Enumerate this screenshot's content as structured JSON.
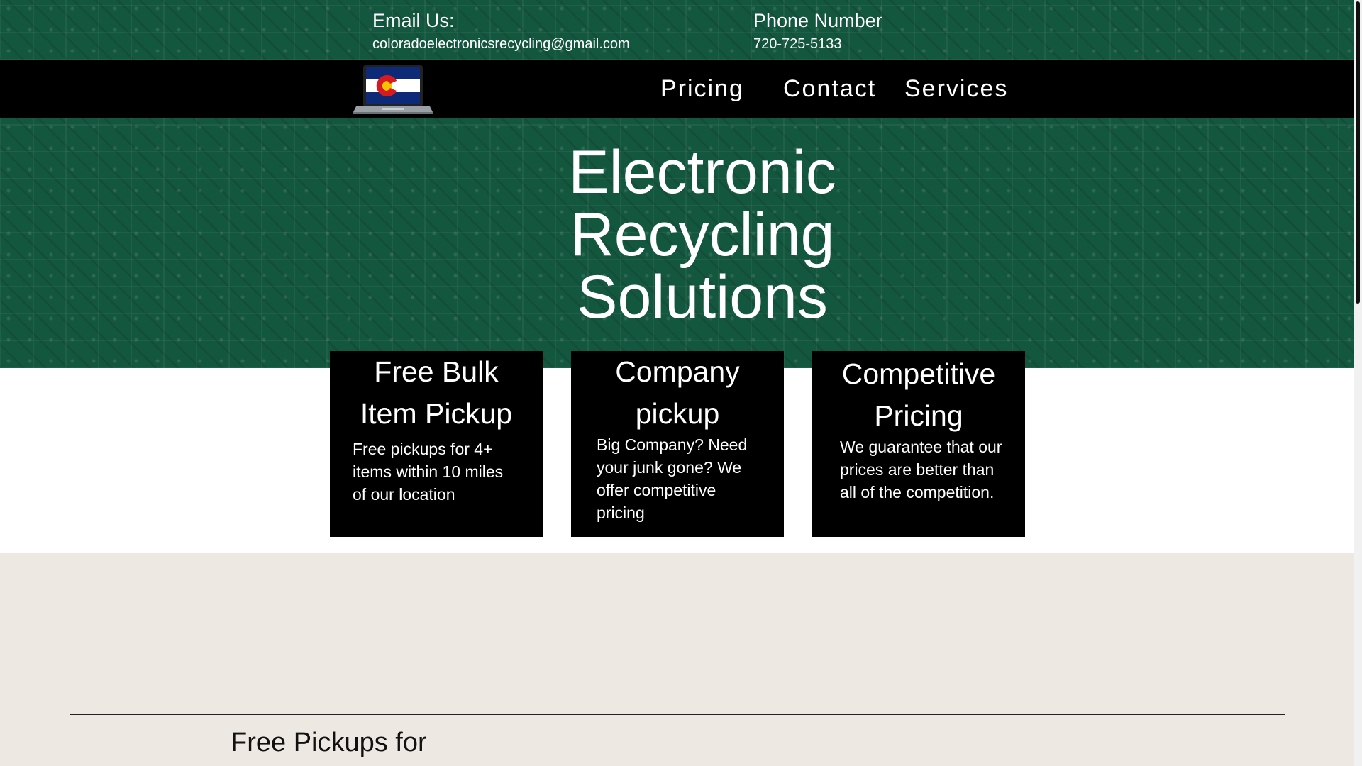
{
  "contact": {
    "email_label": "Email Us:",
    "email_value": "coloradoelectronicsrecycling@gmail.com",
    "phone_label": "Phone Number",
    "phone_value": "720-725-5133"
  },
  "nav": {
    "items": [
      {
        "label": "Pricing"
      },
      {
        "label": "Contact"
      },
      {
        "label": "Services"
      }
    ]
  },
  "hero": {
    "title_lines": [
      "Electronic",
      "Recycling",
      "Solutions"
    ]
  },
  "cards": [
    {
      "title_lines": [
        "Free Bulk",
        "Item Pickup"
      ],
      "description_lines": [
        "Free pickups for 4+",
        "items within 10 miles",
        "of our location"
      ]
    },
    {
      "title_lines": [
        "Company",
        "pickup"
      ],
      "description_lines": [
        "Big Company? Need",
        "your junk gone? We",
        "offer competitive",
        "pricing"
      ]
    },
    {
      "title_lines": [
        "Competitive",
        "Pricing"
      ],
      "description_lines": [
        "We guarantee that our",
        "prices are better than",
        "all of the competition."
      ]
    }
  ],
  "section": {
    "heading": "Free Pickups for"
  },
  "colors": {
    "pcb_green": "#14573f",
    "nav_black": "#000000",
    "card_black": "#000000",
    "light_bg": "#ede9e2",
    "flag_blue": "#0c2a78",
    "flag_red": "#d71920",
    "flag_gold": "#f5c400"
  },
  "icons": {
    "logo": "colorado-flag-laptop-icon"
  }
}
